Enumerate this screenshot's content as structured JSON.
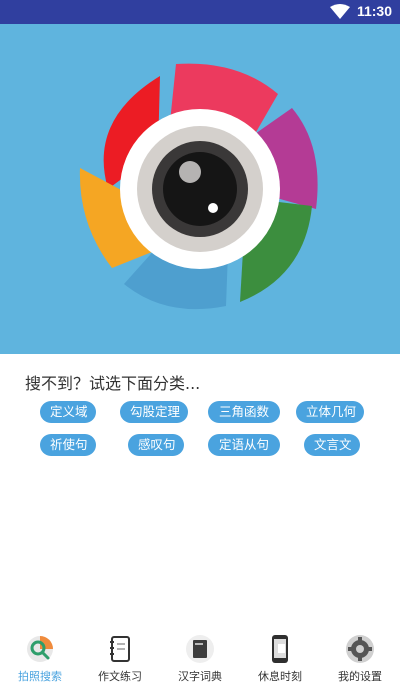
{
  "status_bar": {
    "time": "11:30",
    "icons": [
      "wifi-icon"
    ]
  },
  "hero": {
    "image": "camera-shutter-logo",
    "background": "#5fb4de"
  },
  "prompt": "搜不到？试选下面分类...",
  "categories": [
    "定义域",
    "勾股定理",
    "三角函数",
    "立体几何",
    "祈使句",
    "感叹句",
    "定语从句",
    "文言文"
  ],
  "accent": "#4aa3df",
  "tabs": [
    {
      "label": "拍照搜索",
      "icon": "photo-search-icon",
      "active": true
    },
    {
      "label": "作文练习",
      "icon": "notebook-icon",
      "active": false
    },
    {
      "label": "汉字词典",
      "icon": "dictionary-icon",
      "active": false
    },
    {
      "label": "休息时刻",
      "icon": "phone-icon",
      "active": false
    },
    {
      "label": "我的设置",
      "icon": "gear-icon",
      "active": false
    }
  ]
}
